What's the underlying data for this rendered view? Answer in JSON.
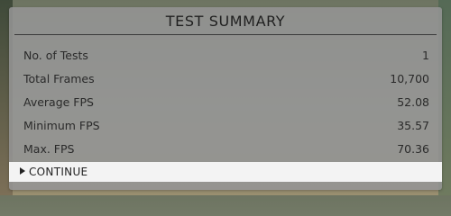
{
  "summary": {
    "title": "TEST SUMMARY",
    "rows": [
      {
        "label": "No. of Tests",
        "value": "1"
      },
      {
        "label": "Total Frames",
        "value": "10,700"
      },
      {
        "label": "Average FPS",
        "value": "52.08"
      },
      {
        "label": "Minimum FPS",
        "value": "35.57"
      },
      {
        "label": "Max. FPS",
        "value": "70.36"
      }
    ],
    "continue_label": "CONTINUE"
  },
  "icons": {
    "continue": "play-triangle-icon"
  },
  "colors": {
    "panel": "#949494",
    "continue_bg": "#f3f3f3",
    "text": "#2a2a2a"
  }
}
